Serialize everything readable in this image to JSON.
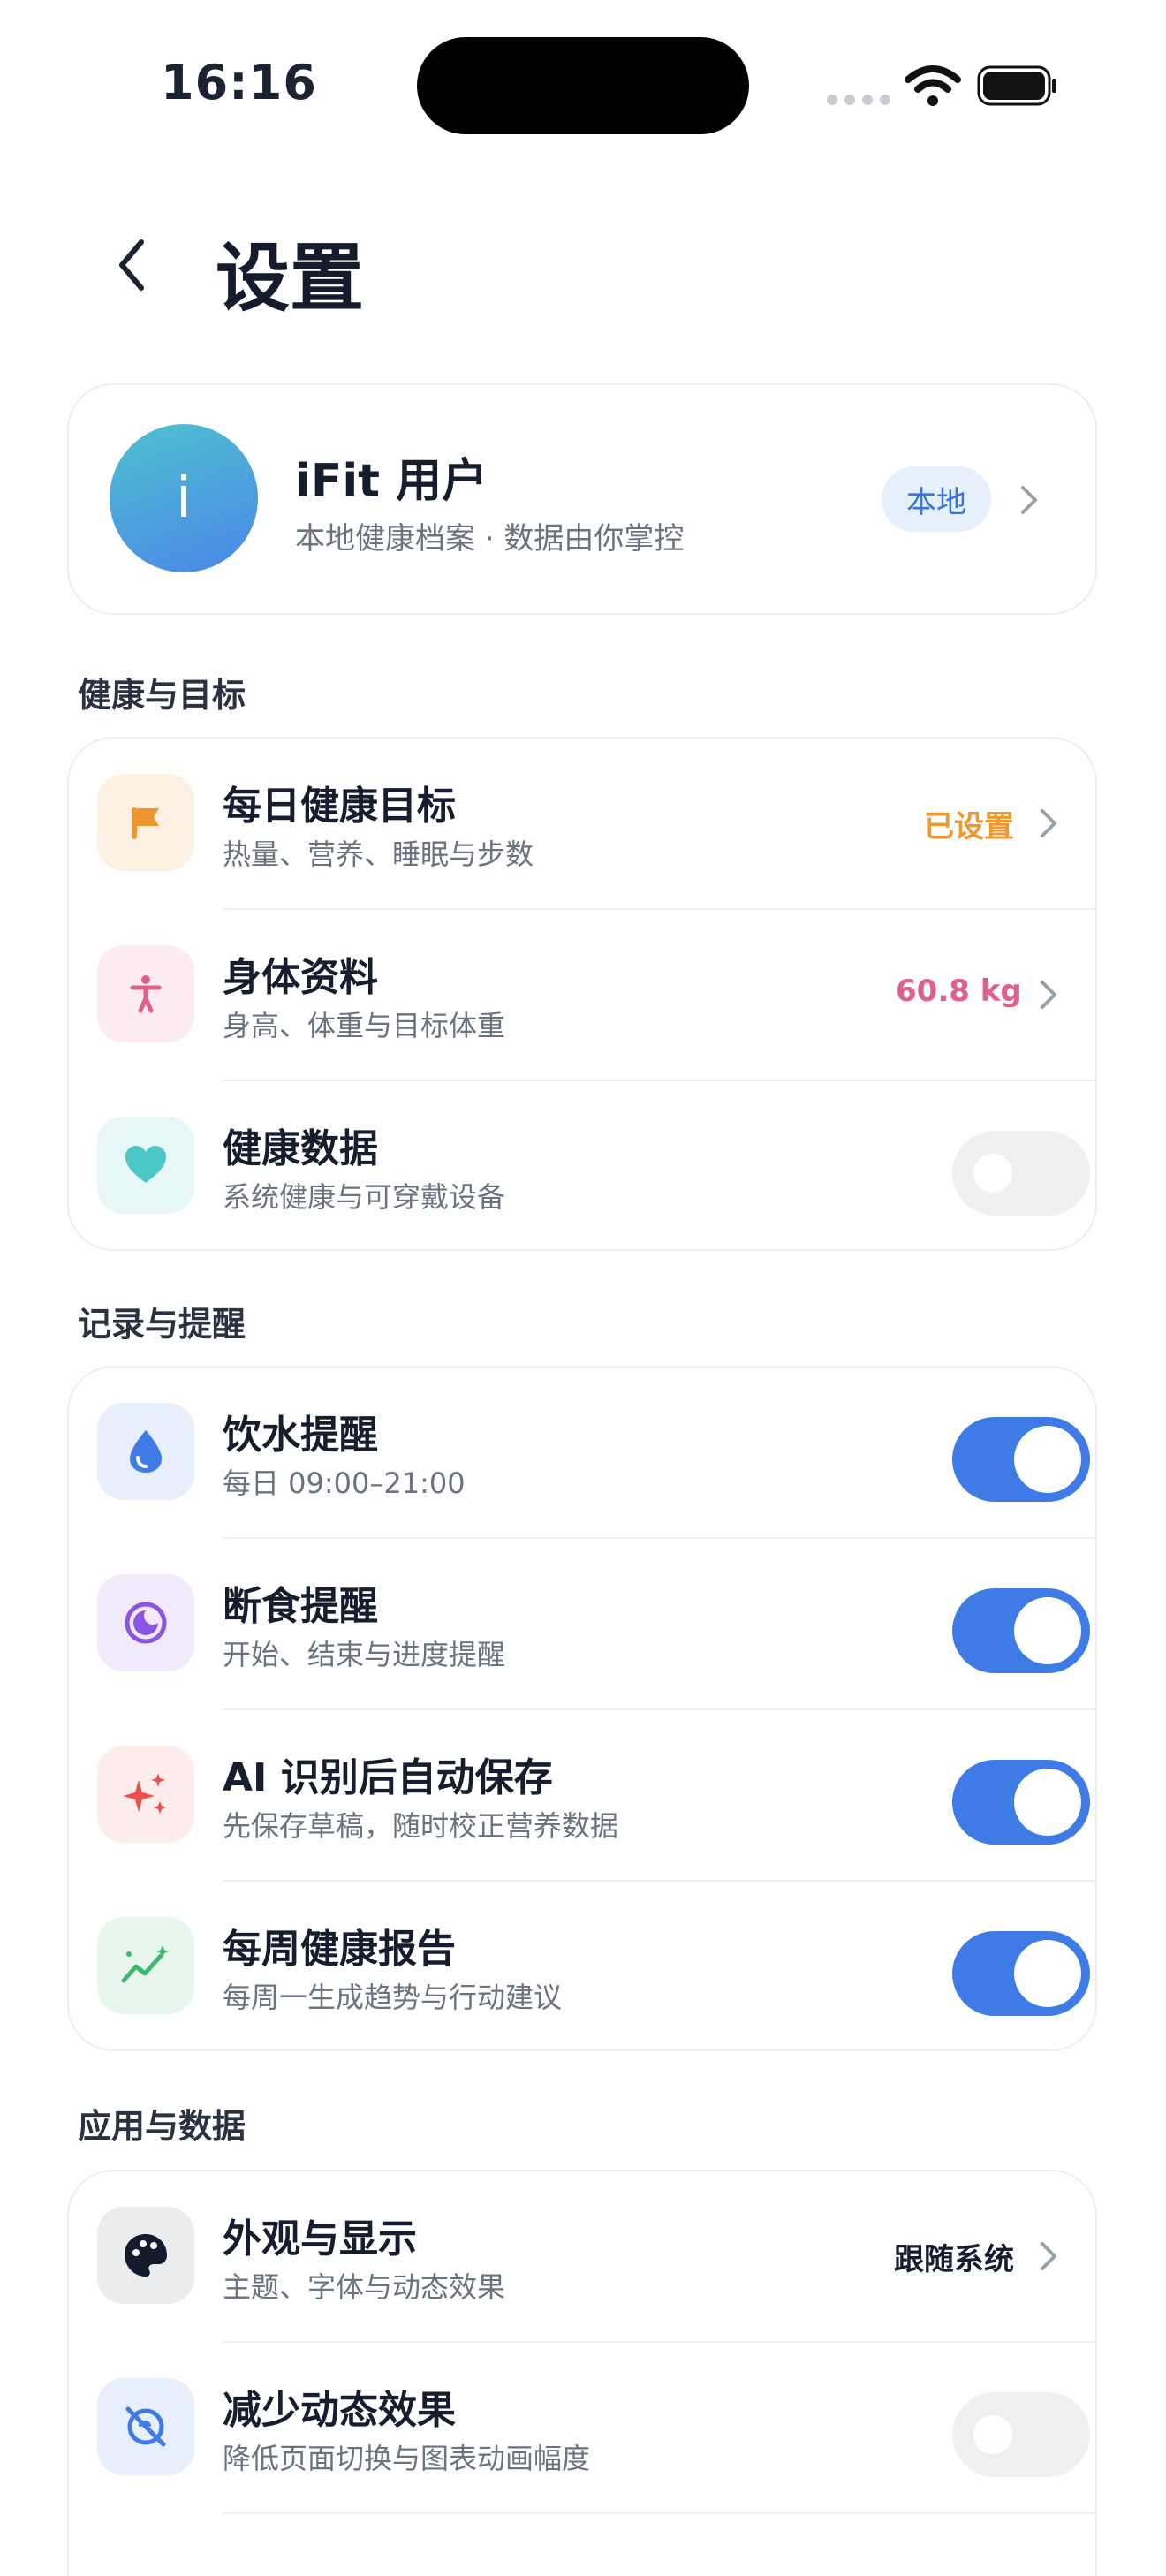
{
  "status_bar": {
    "time": "16:16"
  },
  "header": {
    "title": "设置"
  },
  "profile": {
    "avatar_letter": "i",
    "name": "iFit 用户",
    "subtitle": "本地健康档案 · 数据由你掌控",
    "badge": "本地"
  },
  "sections": {
    "health": {
      "title": "健康与目标",
      "items": [
        {
          "title": "每日健康目标",
          "subtitle": "热量、营养、睡眠与步数",
          "value": "已设置",
          "icon": "flag-icon"
        },
        {
          "title": "身体资料",
          "subtitle": "身高、体重与目标体重",
          "value": "60.8 kg",
          "icon": "person-icon"
        },
        {
          "title": "健康数据",
          "subtitle": "系统健康与可穿戴设备",
          "toggle": false,
          "icon": "heart-icon"
        }
      ]
    },
    "reminders": {
      "title": "记录与提醒",
      "items": [
        {
          "title": "饮水提醒",
          "subtitle": "每日 09:00–21:00",
          "toggle": true,
          "icon": "water-drop-icon"
        },
        {
          "title": "断食提醒",
          "subtitle": "开始、结束与进度提醒",
          "toggle": true,
          "icon": "moon-icon"
        },
        {
          "title": "AI 识别后自动保存",
          "subtitle": "先保存草稿，随时校正营养数据",
          "toggle": true,
          "icon": "sparkle-icon"
        },
        {
          "title": "每周健康报告",
          "subtitle": "每周一生成趋势与行动建议",
          "toggle": true,
          "icon": "trend-icon"
        }
      ]
    },
    "app": {
      "title": "应用与数据",
      "items": [
        {
          "title": "外观与显示",
          "subtitle": "主题、字体与动态效果",
          "value": "跟随系统",
          "icon": "palette-icon"
        },
        {
          "title": "减少动态效果",
          "subtitle": "降低页面切换与图表动画幅度",
          "toggle": false,
          "icon": "motion-off-icon"
        }
      ]
    }
  },
  "colors": {
    "accent": "#3f7be6",
    "orange": "#f0962e",
    "pink": "#e0608a",
    "teal": "#4cc7c7"
  }
}
